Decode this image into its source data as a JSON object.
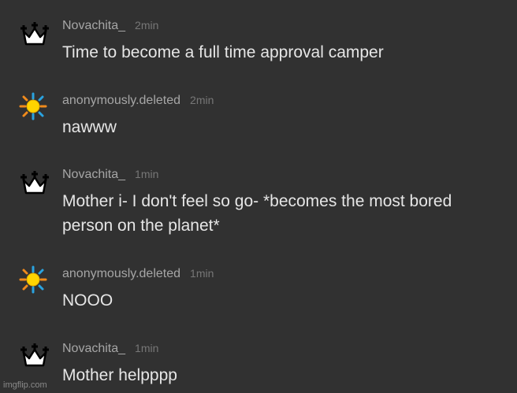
{
  "messages": [
    {
      "user": "Novachita_",
      "time": "2min",
      "text": "Time to become a full time approval camper",
      "avatar": "crown-icon"
    },
    {
      "user": "anonymously.deleted",
      "time": "2min",
      "text": "nawww",
      "avatar": "sun-icon"
    },
    {
      "user": "Novachita_",
      "time": "1min",
      "text": "Mother i- I don't feel so go- *becomes the most bored person on the planet*",
      "avatar": "crown-icon"
    },
    {
      "user": "anonymously.deleted",
      "time": "1min",
      "text": "NOOO",
      "avatar": "sun-icon"
    },
    {
      "user": "Novachita_",
      "time": "1min",
      "text": "Mother helpppp",
      "avatar": "crown-icon"
    }
  ],
  "watermark": "imgflip.com",
  "colors": {
    "background": "#313131",
    "username": "#a6a6a6",
    "timestamp": "#777777",
    "message_text": "#e6e6e6",
    "sun_core": "#ffd400",
    "sun_rays_blue": "#2aa3e0",
    "sun_rays_orange": "#f08a1c"
  }
}
